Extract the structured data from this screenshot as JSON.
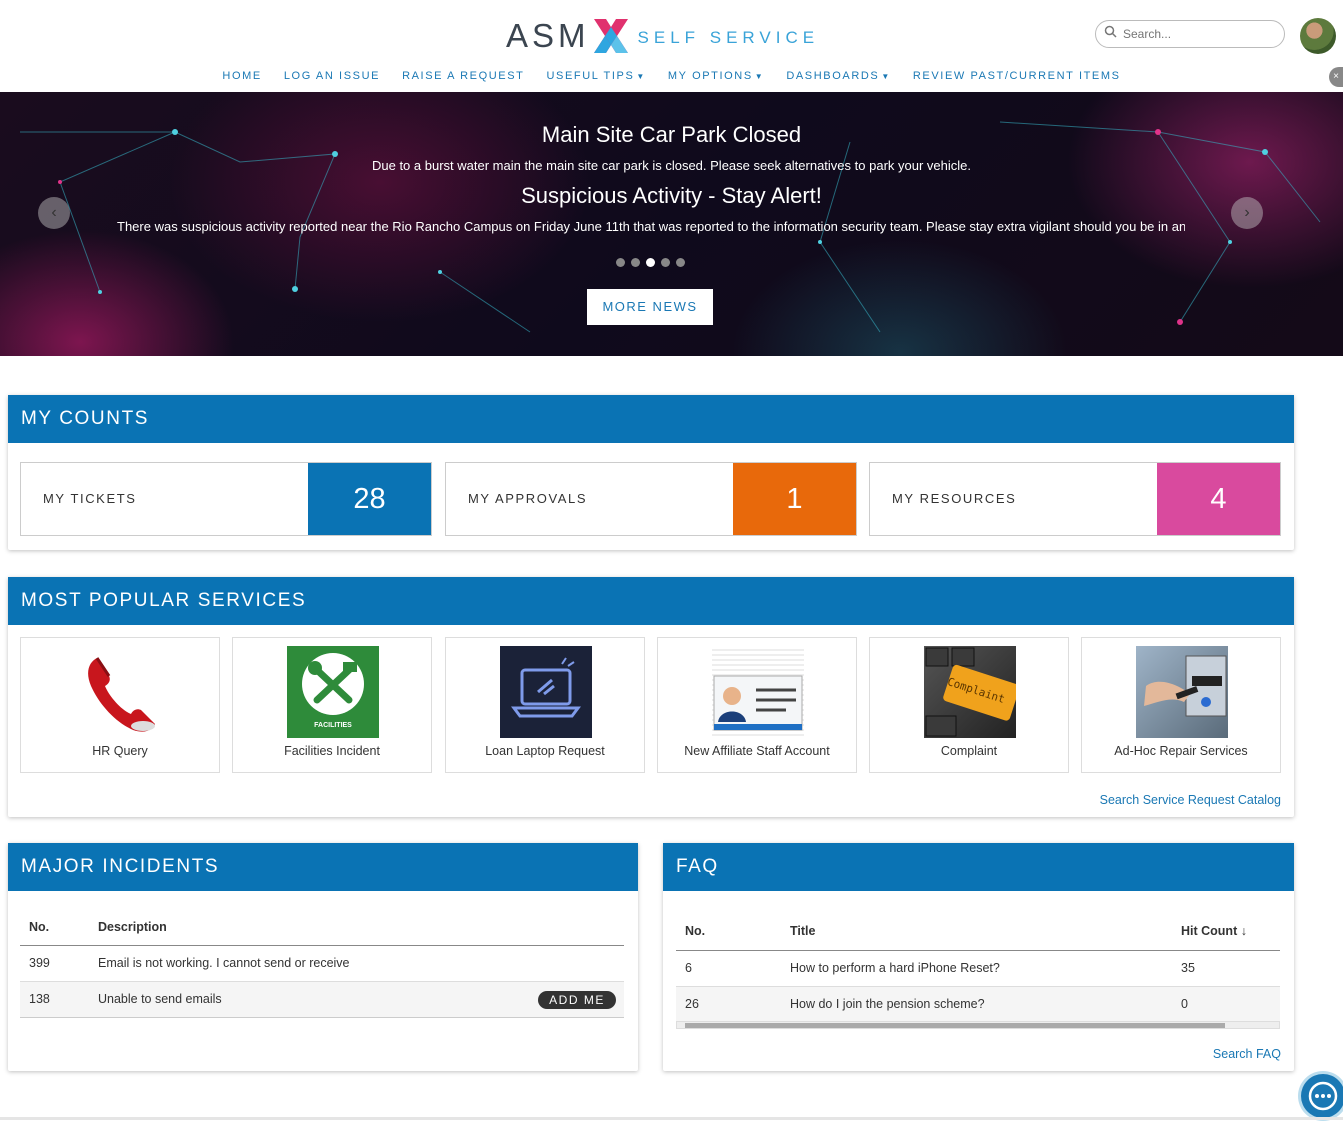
{
  "header": {
    "logo_asm": "ASM",
    "logo_sub": "SELF SERVICE",
    "search_placeholder": "Search...",
    "nav": [
      "HOME",
      "LOG AN ISSUE",
      "RAISE A REQUEST",
      "USEFUL TIPS",
      "MY OPTIONS",
      "DASHBOARDS",
      "REVIEW PAST/CURRENT ITEMS"
    ]
  },
  "hero": {
    "title1": "Main Site Car Park Closed",
    "text1": "Due to a burst water main the main site car park is closed. Please seek alternatives to park your vehicle.",
    "title2": "Suspicious Activity - Stay Alert!",
    "text2": "There was suspicious activity reported near the Rio Rancho Campus on Friday June 11th that was reported to the information security team. Please stay extra vigilant should you be in and around the c",
    "more_news": "MORE NEWS",
    "slide_count": 5,
    "active_slide": 3
  },
  "counts": {
    "title": "MY COUNTS",
    "tickets_label": "MY TICKETS",
    "tickets_value": "28",
    "approvals_label": "MY APPROVALS",
    "approvals_value": "1",
    "resources_label": "MY RESOURCES",
    "resources_value": "4",
    "colors": {
      "tickets": "#0a73b4",
      "approvals": "#e8690b",
      "resources": "#d94a9e"
    }
  },
  "services": {
    "title": "MOST POPULAR SERVICES",
    "items": [
      "HR Query",
      "Facilities Incident",
      "Loan Laptop Request",
      "New Affiliate Staff Account",
      "Complaint",
      "Ad-Hoc Repair Services"
    ],
    "facilities_caption": "FACILITIES",
    "complaint_caption": "Complaint",
    "link": "Search Service Request Catalog"
  },
  "incidents": {
    "title": "MAJOR INCIDENTS",
    "col_no": "No.",
    "col_desc": "Description",
    "rows": [
      {
        "no": "399",
        "desc": "Email is not working.  I cannot send or receive"
      },
      {
        "no": "138",
        "desc": "Unable to send emails"
      }
    ],
    "add_me": "ADD ME"
  },
  "faq": {
    "title": "FAQ",
    "col_no": "No.",
    "col_title": "Title",
    "col_hits": "Hit Count",
    "rows": [
      {
        "no": "6",
        "title": "How to perform a hard iPhone Reset?",
        "hits": "35"
      },
      {
        "no": "26",
        "title": "How do I join the pension scheme?",
        "hits": "0"
      }
    ],
    "link": "Search FAQ"
  },
  "brand_color": "#0a73b4"
}
